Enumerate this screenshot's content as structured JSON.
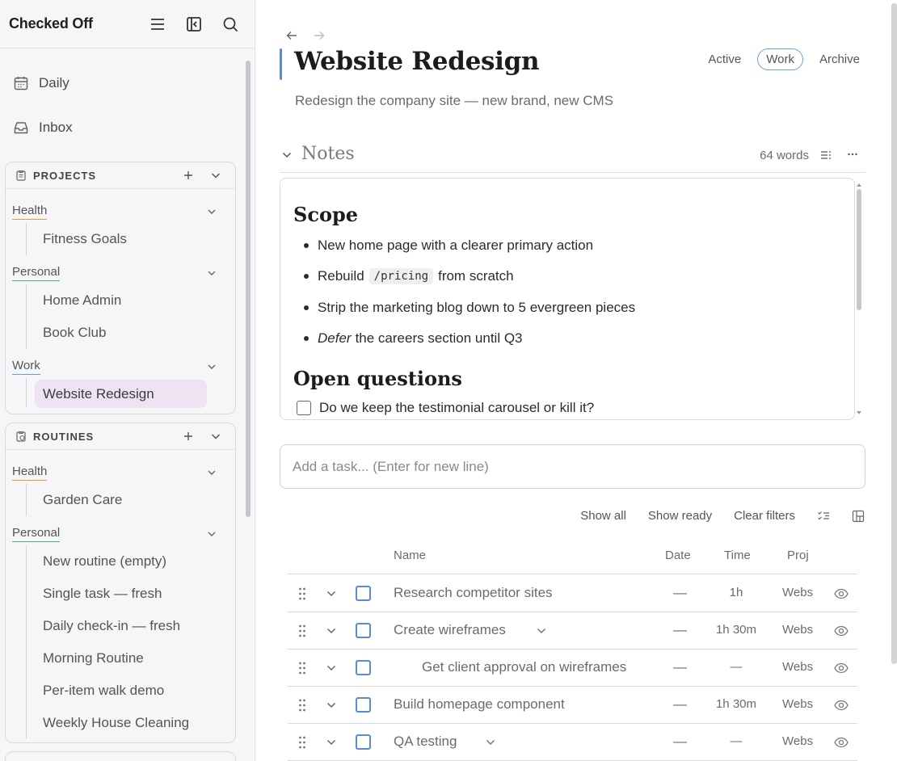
{
  "app": {
    "title": "Checked Off"
  },
  "sidebar": {
    "nav": [
      {
        "label": "Daily",
        "icon": "calendar-icon"
      },
      {
        "label": "Inbox",
        "icon": "inbox-icon"
      }
    ],
    "projects": {
      "header": "PROJECTS",
      "groups": [
        {
          "name": "Health",
          "items": [
            "Fitness Goals"
          ]
        },
        {
          "name": "Personal",
          "items": [
            "Home Admin",
            "Book Club"
          ]
        },
        {
          "name": "Work",
          "items": [
            "Website Redesign"
          ]
        }
      ],
      "active_item": "Website Redesign"
    },
    "routines": {
      "header": "ROUTINES",
      "groups": [
        {
          "name": "Health",
          "items": [
            "Garden Care"
          ]
        },
        {
          "name": "Personal",
          "items": [
            "New routine (empty)",
            "Single task — fresh",
            "Daily check-in — fresh",
            "Morning Routine",
            "Per-item walk demo",
            "Weekly House Cleaning"
          ]
        }
      ]
    }
  },
  "page": {
    "title": "Website Redesign",
    "subtitle": "Redesign the company site — new brand, new CMS",
    "status_tabs": [
      "Active",
      "Work",
      "Archive"
    ],
    "selected_status": "Work",
    "accent_color": "#5b8bd6"
  },
  "notes": {
    "title": "Notes",
    "word_count": "64 words",
    "scope_heading": "Scope",
    "bullets": {
      "b1": "New home page with a clearer primary action",
      "b2_pre": "Rebuild",
      "b2_code": "/pricing",
      "b2_post": "from scratch",
      "b3": "Strip the marketing blog down to 5 evergreen pieces",
      "b4_em": "Defer",
      "b4_rest": "the careers section until Q3"
    },
    "open_heading": "Open questions",
    "checklist": [
      "Do we keep the testimonial carousel or kill it?"
    ]
  },
  "task_input": {
    "placeholder": "Add a task... (Enter for new line)"
  },
  "filters": {
    "show_all": "Show all",
    "show_ready": "Show ready",
    "clear": "Clear filters"
  },
  "table": {
    "columns": {
      "name": "Name",
      "date": "Date",
      "time": "Time",
      "proj": "Proj"
    },
    "rows": [
      {
        "name": "Research competitor sites",
        "date": "—",
        "time": "1h",
        "proj": "Webs"
      },
      {
        "name": "Create wireframes",
        "date": "—",
        "time": "1h 30m",
        "proj": "Webs"
      },
      {
        "name": "Get client approval on wireframes",
        "date": "—",
        "time": "—",
        "proj": "Webs"
      },
      {
        "name": "Build homepage component",
        "date": "—",
        "time": "1h 30m",
        "proj": "Webs"
      },
      {
        "name": "QA testing",
        "date": "—",
        "time": "—",
        "proj": "Webs"
      }
    ]
  }
}
